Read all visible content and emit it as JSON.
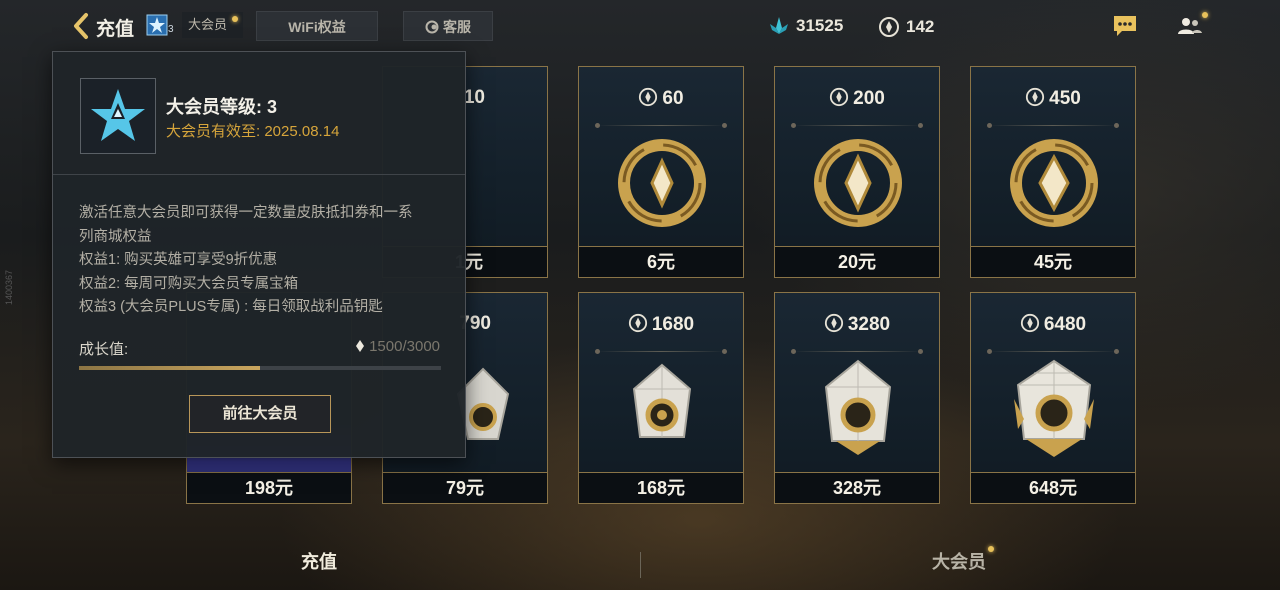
{
  "header": {
    "title": "充值",
    "vip_level_badge": "3",
    "vip_chip_label": "大会员",
    "wifi_label": "WiFi权益",
    "service_label": "客服"
  },
  "currencies": [
    {
      "icon": "coupon-crystal-icon",
      "value": "31525"
    },
    {
      "icon": "coin-icon",
      "value": "142"
    }
  ],
  "version_text": "1400367",
  "cards": [
    {
      "amount": "10",
      "price": "1元"
    },
    {
      "amount": "60",
      "price": "6元"
    },
    {
      "amount": "200",
      "price": "20元"
    },
    {
      "amount": "450",
      "price": "45元"
    },
    {
      "amount": "",
      "price": "198元"
    },
    {
      "amount": "790",
      "price": "79元"
    },
    {
      "amount": "1680",
      "price": "168元"
    },
    {
      "amount": "3280",
      "price": "328元"
    },
    {
      "amount": "6480",
      "price": "648元"
    }
  ],
  "popup": {
    "level_title": "大会员等级: 3",
    "valid_until": "大会员有效至: 2025.08.14",
    "desc_lines": [
      "激活任意大会员即可获得一定数量皮肤抵扣券和一系",
      "列商城权益",
      "权益1: 购买英雄可享受9折优惠",
      "权益2: 每周可购买大会员专属宝箱",
      "权益3 (大会员PLUS专属) : 每日领取战利品钥匙"
    ],
    "growth_label": "成长值:",
    "growth_value": "1500/3000",
    "growth_progress": 0.5,
    "go_button": "前往大会员"
  },
  "bottom_tabs": {
    "recharge": "充值",
    "vip": "大会员"
  },
  "colors": {
    "gold": "#d6a53b",
    "card_border": "#8a7447"
  }
}
